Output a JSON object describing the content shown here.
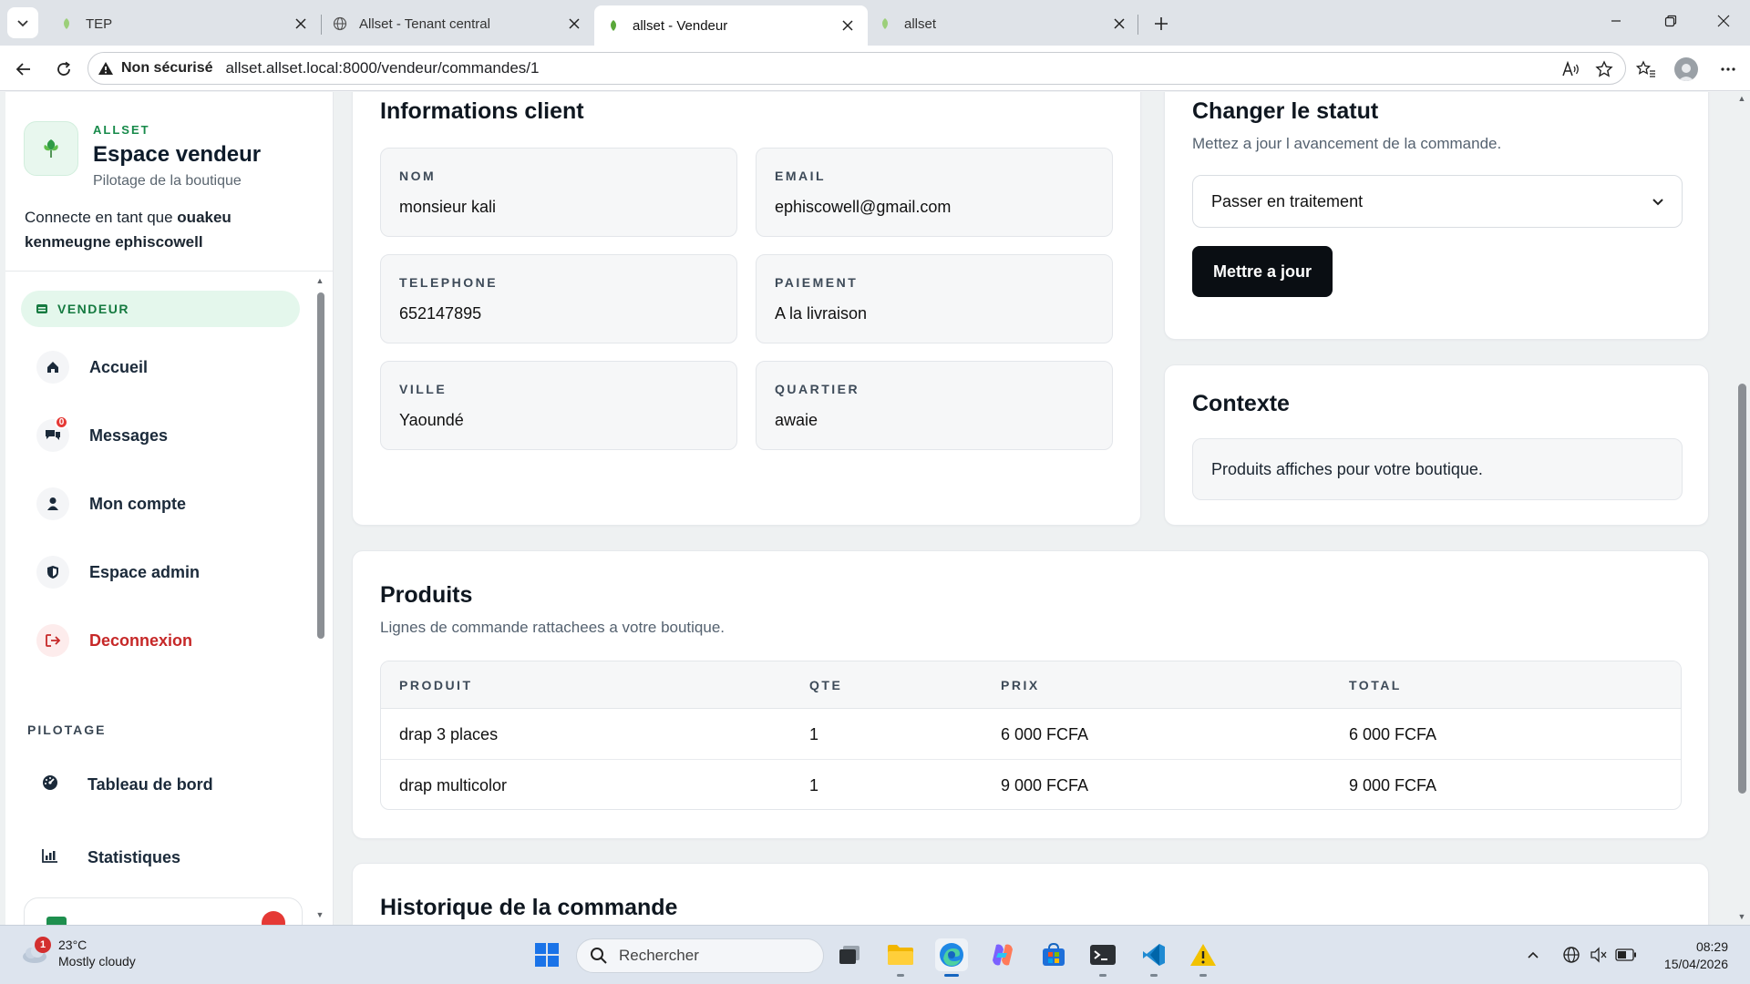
{
  "browser": {
    "tabs": [
      {
        "title": "TEP",
        "icon": "leaf-icon"
      },
      {
        "title": "Allset - Tenant central",
        "icon": "globe-icon"
      },
      {
        "title": "allset - Vendeur",
        "icon": "leaf-icon"
      },
      {
        "title": "allset",
        "icon": "leaf-icon"
      }
    ],
    "security_label": "Non sécurisé",
    "url": "allset.allset.local:8000/vendeur/commandes/1"
  },
  "sidebar": {
    "brand_kicker": "ALLSET",
    "brand_title": "Espace vendeur",
    "brand_subtitle": "Pilotage de la boutique",
    "connected_prefix": "Connecte en tant que ",
    "connected_user": "ouakeu kenmeugne ephiscowell",
    "role": "VENDEUR",
    "items": [
      {
        "label": "Accueil",
        "icon": "home-icon"
      },
      {
        "label": "Messages",
        "icon": "chat-icon",
        "badge": "0"
      },
      {
        "label": "Mon compte",
        "icon": "user-icon"
      },
      {
        "label": "Espace admin",
        "icon": "shield-icon"
      },
      {
        "label": "Deconnexion",
        "icon": "logout-icon"
      }
    ],
    "section_label": "PILOTAGE",
    "pilotage_items": [
      {
        "label": "Tableau de bord",
        "icon": "gauge-icon"
      },
      {
        "label": "Statistiques",
        "icon": "bar-chart-icon"
      }
    ]
  },
  "client": {
    "title": "Informations client",
    "fields": [
      {
        "key": "NOM",
        "value": "monsieur kali"
      },
      {
        "key": "EMAIL",
        "value": "ephiscowell@gmail.com"
      },
      {
        "key": "TELEPHONE",
        "value": "652147895"
      },
      {
        "key": "PAIEMENT",
        "value": "A la livraison"
      },
      {
        "key": "VILLE",
        "value": "Yaoundé"
      },
      {
        "key": "QUARTIER",
        "value": "awaie"
      }
    ]
  },
  "status": {
    "title": "Changer le statut",
    "subtitle": "Mettez a jour l avancement de la commande.",
    "selected": "Passer en traitement",
    "button": "Mettre a jour"
  },
  "context": {
    "title": "Contexte",
    "text": "Produits affiches pour votre boutique."
  },
  "products": {
    "title": "Produits",
    "subtitle": "Lignes de commande rattachees a votre boutique.",
    "columns": [
      "PRODUIT",
      "QTE",
      "PRIX",
      "TOTAL"
    ],
    "rows": [
      [
        "drap 3 places",
        "1",
        "6 000 FCFA",
        "6 000 FCFA"
      ],
      [
        "drap multicolor",
        "1",
        "9 000 FCFA",
        "9 000 FCFA"
      ]
    ]
  },
  "history": {
    "title": "Historique de la commande"
  },
  "taskbar": {
    "weather_temp": "23°C",
    "weather_desc": "Mostly cloudy",
    "weather_badge": "1",
    "search_label": "Rechercher",
    "time": "08:29",
    "date": "15/04/2026"
  },
  "colors": {
    "accent_green": "#178a4a",
    "danger_red": "#c62828",
    "primary_button": "#0a0e13"
  }
}
